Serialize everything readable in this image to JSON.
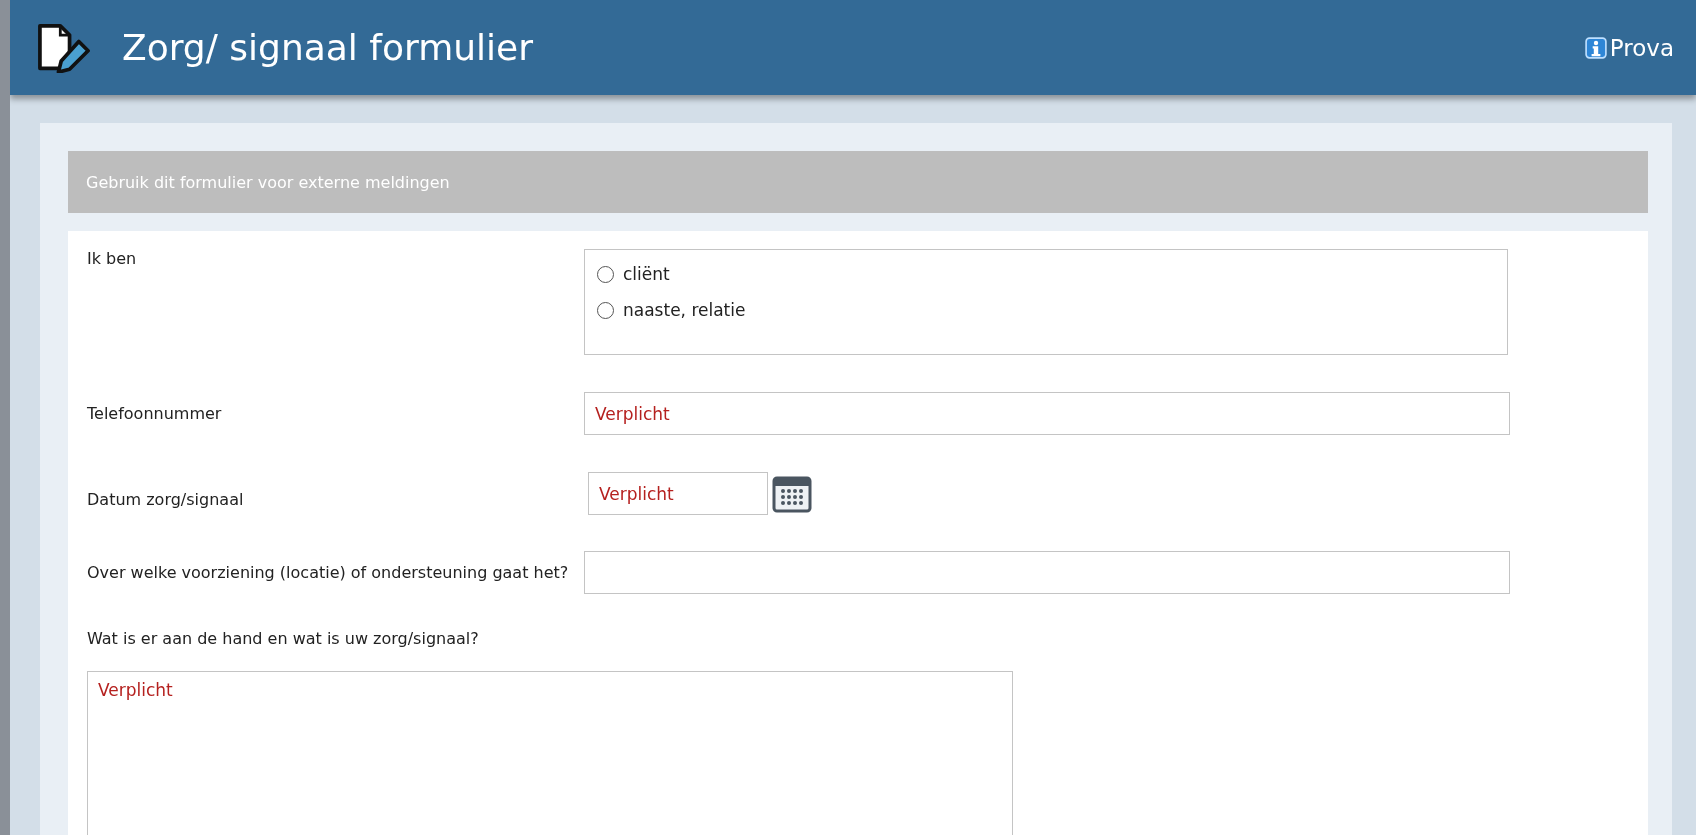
{
  "header": {
    "title": "Zorg/ signaal formulier",
    "brand": "Prova"
  },
  "banner": "Gebruik dit formulier voor externe meldingen",
  "fields": [
    {
      "kind": "radio",
      "label": "Ik ben",
      "options": [
        {
          "label": "cliënt",
          "selected": false
        },
        {
          "label": "naaste, relatie",
          "selected": false
        }
      ]
    },
    {
      "kind": "text",
      "label": "Telefoonnummer",
      "placeholder": "Verplicht"
    },
    {
      "kind": "date",
      "label": "Datum zorg/signaal",
      "placeholder": "Verplicht"
    },
    {
      "kind": "text",
      "label": "Over welke voorziening (locatie) of ondersteuning gaat het?"
    },
    {
      "kind": "textarea",
      "label": "Wat is er aan de hand en wat is uw zorg/signaal?",
      "placeholder": "Verplicht"
    }
  ]
}
